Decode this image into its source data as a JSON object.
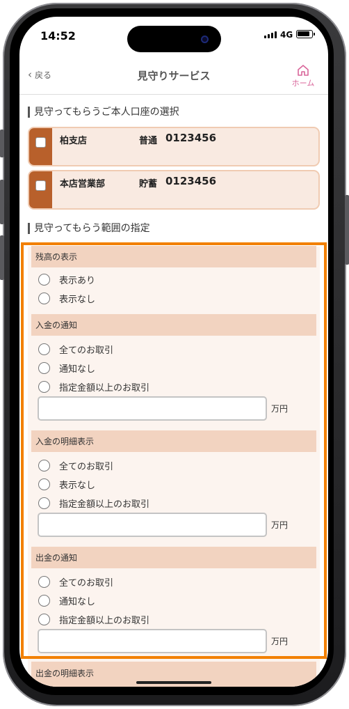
{
  "status": {
    "time": "14:52",
    "network": "4G"
  },
  "nav": {
    "back_label": "戻る",
    "title": "見守りサービス",
    "home_label": "ホーム"
  },
  "accounts_section": {
    "title": "見守ってもらうご本人口座の選択",
    "accounts": [
      {
        "branch": "柏支店",
        "type": "普通",
        "number": "0123456"
      },
      {
        "branch": "本店営業部",
        "type": "貯蓄",
        "number": "0123456"
      }
    ]
  },
  "range_section": {
    "title": "見守ってもらう範囲の指定",
    "groups": [
      {
        "title": "残高の表示",
        "options": [
          "表示あり",
          "表示なし"
        ]
      },
      {
        "title": "入金の通知",
        "options": [
          "全てのお取引",
          "通知なし",
          "指定金額以上のお取引"
        ],
        "amount_unit": "万円"
      },
      {
        "title": "入金の明細表示",
        "options": [
          "全てのお取引",
          "表示なし",
          "指定金額以上のお取引"
        ],
        "amount_unit": "万円"
      },
      {
        "title": "出金の通知",
        "options": [
          "全てのお取引",
          "通知なし",
          "指定金額以上のお取引"
        ],
        "amount_unit": "万円"
      },
      {
        "title": "出金の明細表示"
      }
    ]
  },
  "colors": {
    "accent_orange": "#f28000",
    "account_strip": "#b8602b",
    "home_pink": "#d9669a",
    "group_header": "#f2d3c0"
  }
}
